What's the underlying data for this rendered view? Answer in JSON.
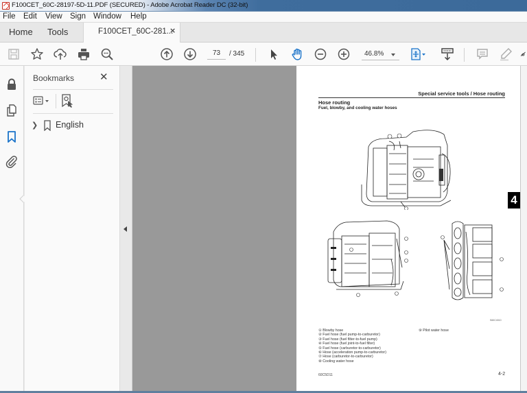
{
  "window": {
    "title": "F100CET_60C-28197-5D-11.PDF (SECURED) - Adobe Acrobat Reader DC (32-bit)"
  },
  "menu": [
    "File",
    "Edit",
    "View",
    "Sign",
    "Window",
    "Help"
  ],
  "tabs": {
    "home": "Home",
    "tools": "Tools",
    "document": "F100CET_60C-281...",
    "close_glyph": "×"
  },
  "toolbar": {
    "icons": [
      "save-icon",
      "bookmark-star-icon",
      "upload-cloud-icon",
      "print-icon",
      "search-zoom-icon",
      "previous-page-icon",
      "next-page-icon",
      "select-cursor-icon",
      "hand-tool-icon",
      "zoom-out-icon",
      "zoom-in-icon",
      "fit-page-icon",
      "scroll-mode-icon",
      "comment-icon",
      "highlight-pen-icon",
      "sign-icon"
    ],
    "current_page": "73",
    "total_pages": "/ 345",
    "zoom": "46.8%",
    "accent_color": "#1a73c9"
  },
  "left_rail": {
    "icons": [
      "lock-icon",
      "pages-icon",
      "bookmarks-icon",
      "attachment-icon"
    ],
    "active": "bookmarks-icon"
  },
  "bookmarks_panel": {
    "title": "Bookmarks",
    "close_glyph": "✕",
    "items": [
      {
        "label": "English",
        "expandable": true
      }
    ]
  },
  "document_page": {
    "header": "Special service tools / Hose routing",
    "title": "Hose routing",
    "subtitle": "Fuel, blowby, and cooling water hoses",
    "chapter_tab": "4",
    "figure_id": "S60C4010",
    "legend": [
      "① Blowby hose",
      "② Fuel hose (fuel pump-to-carburetor)",
      "③ Fuel hose (fuel filter-to-fuel pump)",
      "④ Fuel hose (fuel joint-to-fuel filter)",
      "⑤ Fuel hose (carburetor-to-carburetor)",
      "⑥ Hose (acceleration pump-to-carburetor)",
      "⑦ Hose (carburetor-to-carburetor)",
      "⑧ Cooling water hose"
    ],
    "legend_col2": [
      "⑨ Pilot water hose"
    ],
    "footer_left": "60C5D11",
    "footer_right": "4-2"
  }
}
